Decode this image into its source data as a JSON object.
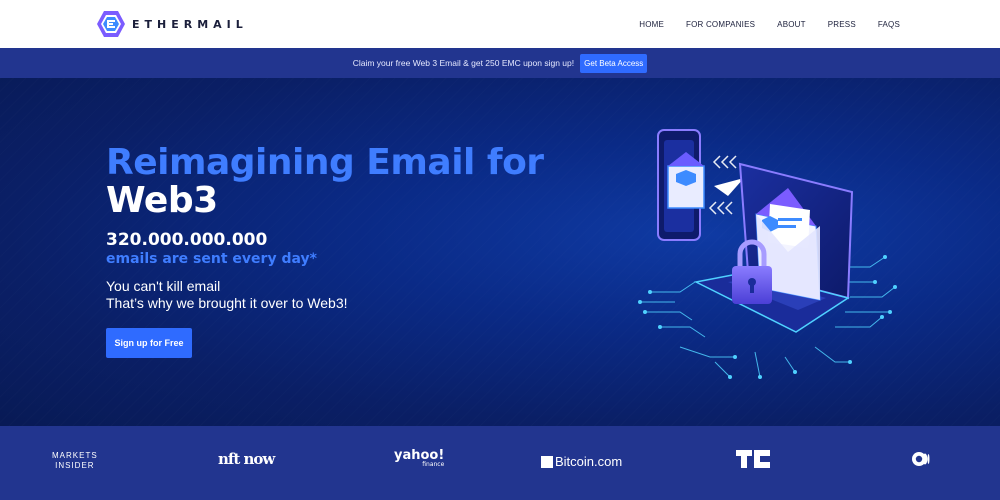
{
  "header": {
    "brand": "ETHERMAIL",
    "nav": [
      "HOME",
      "FOR COMPANIES",
      "ABOUT",
      "PRESS",
      "FAQS"
    ]
  },
  "banner": {
    "text": "Claim your free Web 3 Email & get 250 EMC upon sign up!",
    "button": "Get Beta Access"
  },
  "hero": {
    "title_line1": "Reimagining Email for",
    "title_line2": "Web3",
    "stat_number": "320.000.000.000",
    "stat_caption": "emails are sent every day*",
    "subtitle_line1": "You can't kill email",
    "subtitle_line2": "That’s why we brought it over to Web3!",
    "cta": "Sign up for Free"
  },
  "press": {
    "logos": [
      {
        "name": "markets-insider",
        "line1": "MARKETS",
        "line2": "INSIDER"
      },
      {
        "name": "nft-now",
        "text": "nft now"
      },
      {
        "name": "yahoo-finance",
        "text": "yahoo!",
        "sub": "finance"
      },
      {
        "name": "bitcoin-com",
        "text": "Bitcoin.com"
      },
      {
        "name": "techcrunch",
        "text": ""
      },
      {
        "name": "medium",
        "text": ""
      }
    ]
  },
  "colors": {
    "accent": "#2f6bff",
    "title_blue": "#3f7dff",
    "banner_bg": "#22358f",
    "hero_bg": "#0a2a86"
  }
}
